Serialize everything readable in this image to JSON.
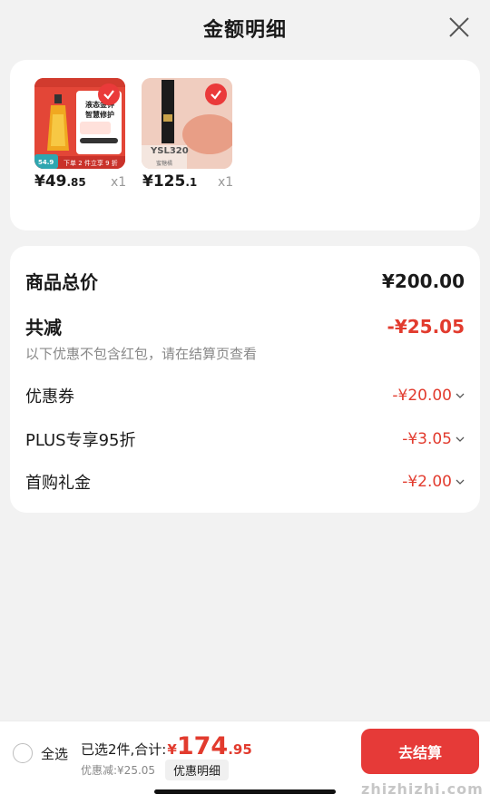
{
  "header": {
    "title": "金额明细"
  },
  "products": [
    {
      "name": "hair-oil",
      "badge_text": "液态金钟\n智慧修护",
      "promo_text": "下单 2 件立享 9 折",
      "small_price": "54.9",
      "price_int": "¥49",
      "price_dec": ".85",
      "qty": "x1"
    },
    {
      "name": "lipstick",
      "label": "YSL320",
      "sub_label": "蜜糖橘",
      "price_int": "¥125",
      "price_dec": ".1",
      "qty": "x1"
    }
  ],
  "summary": {
    "total_label": "商品总价",
    "total_value": "¥200.00",
    "minus_label": "共减",
    "minus_value": "-¥25.05",
    "note": "以下优惠不包含红包，请在结算页查看",
    "items": [
      {
        "label": "优惠券",
        "value": "-¥20.00"
      },
      {
        "label": "PLUS专享95折",
        "value": "-¥3.05"
      },
      {
        "label": "首购礼金",
        "value": "-¥2.00"
      }
    ]
  },
  "bottom": {
    "select_all": "全选",
    "selected_text": "已选2件,合计:",
    "yen": "¥",
    "total_int": "174",
    "total_dec": ".95",
    "discount_text": "优惠减:¥25.05",
    "detail_button": "优惠明细",
    "checkout_button": "去结算",
    "watermark": "zhizhizhi.com"
  },
  "colors": {
    "accent": "#e23b2e",
    "background": "#f2f2f2",
    "checkout": "#e63a38"
  }
}
